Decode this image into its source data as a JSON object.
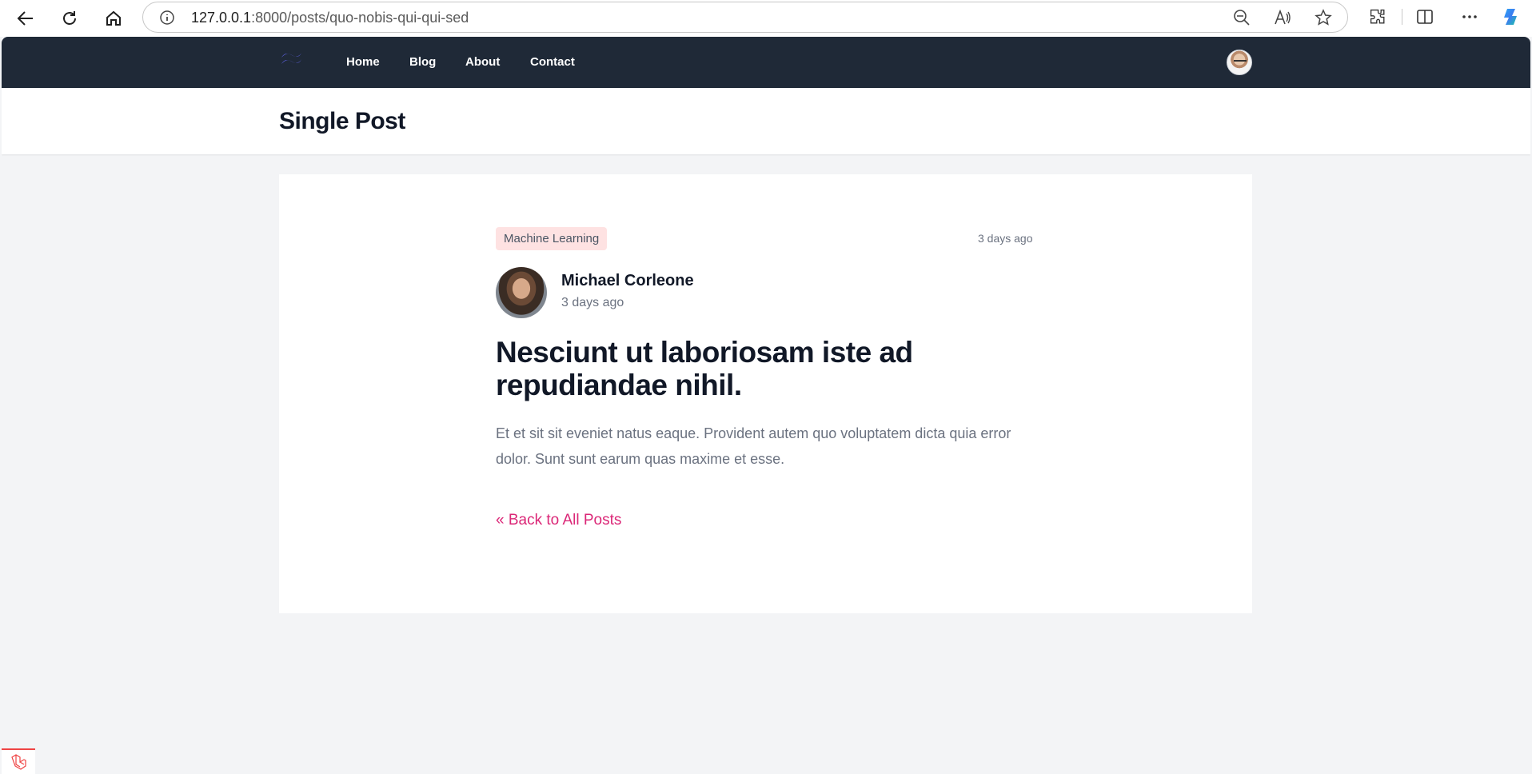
{
  "browser": {
    "url_host": "127.0.0.1",
    "url_path": ":8000/posts/quo-nobis-qui-qui-sed"
  },
  "site_nav": {
    "links": [
      "Home",
      "Blog",
      "About",
      "Contact"
    ]
  },
  "header": {
    "title": "Single Post"
  },
  "post": {
    "category": "Machine Learning",
    "time_top": "3 days ago",
    "author": "Michael Corleone",
    "author_time": "3 days ago",
    "title": "Nesciunt ut laboriosam iste ad repudiandae nihil.",
    "body": "Et et sit sit eveniet natus eaque. Provident autem quo voluptatem dicta quia error dolor. Sunt sunt earum quas maxime et esse.",
    "back_link": "« Back to All Posts"
  },
  "colors": {
    "nav_bg": "#1f2937",
    "badge_bg": "#fee2e2",
    "link": "#db2777",
    "logo": "#6366f1"
  }
}
